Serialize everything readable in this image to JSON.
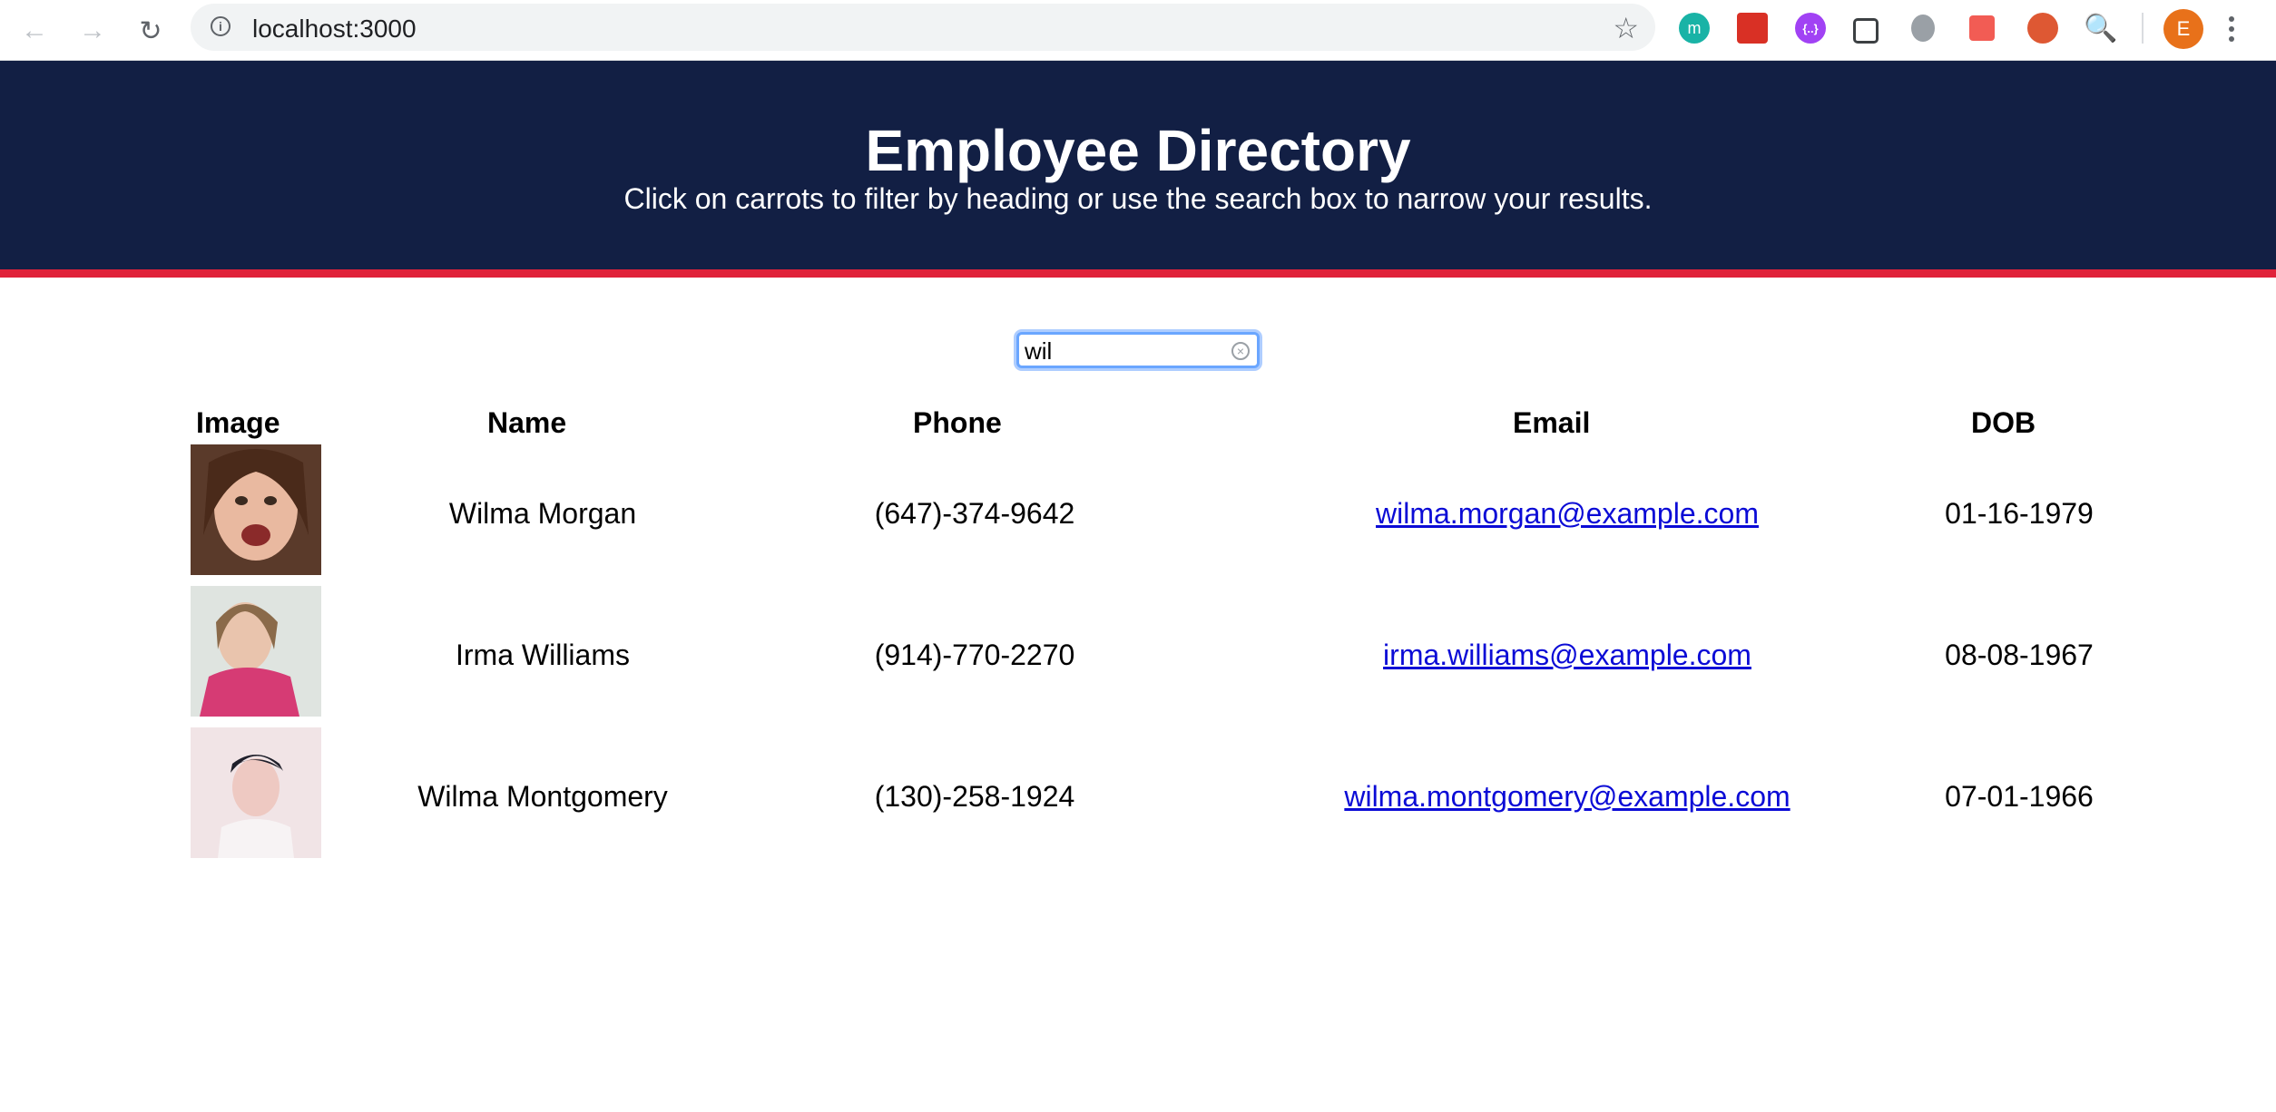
{
  "browser": {
    "url": "localhost:3000",
    "avatar_letter": "E",
    "extensions": [
      "m",
      "",
      "{..}",
      "",
      "",
      "",
      "",
      ""
    ]
  },
  "header": {
    "title": "Employee Directory",
    "subtitle": "Click on carrots to filter by heading or use the search box to narrow your results."
  },
  "search": {
    "value": "wil"
  },
  "table": {
    "columns": [
      "Image",
      "Name",
      "Phone",
      "Email",
      "DOB"
    ],
    "rows": [
      {
        "name": "Wilma Morgan",
        "phone": "(647)-374-9642",
        "email": "wilma.morgan@example.com",
        "dob": "01-16-1979"
      },
      {
        "name": "Irma Williams",
        "phone": "(914)-770-2270",
        "email": "irma.williams@example.com",
        "dob": "08-08-1967"
      },
      {
        "name": "Wilma Montgomery",
        "phone": "(130)-258-1924",
        "email": "wilma.montgomery@example.com",
        "dob": "07-01-1966"
      }
    ]
  },
  "colors": {
    "header_bg": "#121f44",
    "accent_red": "#e0223a",
    "link": "#0b0bd6"
  }
}
